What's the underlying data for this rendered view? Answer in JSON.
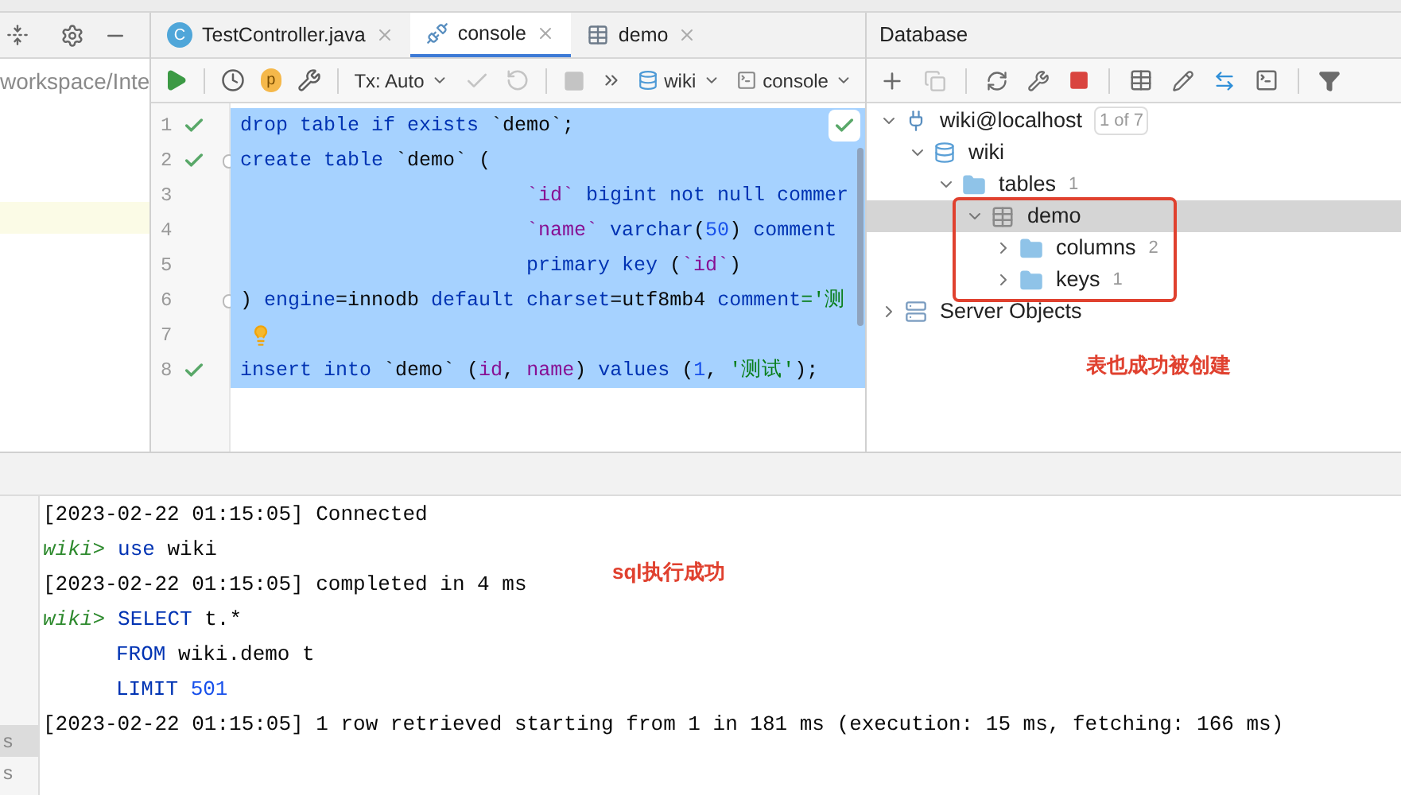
{
  "left_panel": {
    "path": "workspace/Inte",
    "bottom_items": [
      "s",
      "s"
    ]
  },
  "editor": {
    "tabs": [
      {
        "label": "TestController.java",
        "kind": "class",
        "icon_letter": "C",
        "selected": false
      },
      {
        "label": "console",
        "kind": "console",
        "selected": true
      },
      {
        "label": "demo",
        "kind": "table",
        "selected": false
      }
    ],
    "toolbar": [
      {
        "kind": "run",
        "disabled": false
      },
      {
        "kind": "sep"
      },
      {
        "kind": "history",
        "disabled": false
      },
      {
        "kind": "letter",
        "text": "p",
        "disabled": false
      },
      {
        "kind": "settings",
        "disabled": false
      },
      {
        "kind": "sep"
      },
      {
        "kind": "dropdown",
        "text": "Tx: Auto",
        "disabled": false
      },
      {
        "kind": "commit",
        "disabled": true
      },
      {
        "kind": "rollback",
        "disabled": true
      },
      {
        "kind": "sep"
      },
      {
        "kind": "stop",
        "disabled": true
      },
      {
        "kind": "more",
        "disabled": false
      },
      {
        "kind": "schema",
        "text": "wiki",
        "disabled": false
      },
      {
        "kind": "session",
        "text": "console",
        "disabled": false
      }
    ],
    "lines": [
      {
        "number": "1",
        "checked": true,
        "fold": false,
        "indented": false,
        "bulb": false,
        "tokens": [
          {
            "t": "drop table if exists",
            "kind": "kw"
          },
          {
            "t": " `demo`;",
            "kind": "plain"
          }
        ]
      },
      {
        "number": "2",
        "checked": true,
        "fold": true,
        "indented": false,
        "bulb": false,
        "tokens": [
          {
            "t": "create table",
            "kind": "kw"
          },
          {
            "t": " `demo` (",
            "kind": "plain"
          }
        ]
      },
      {
        "number": "3",
        "checked": false,
        "fold": false,
        "indented": true,
        "bulb": false,
        "tokens": [
          {
            "t": "`id`",
            "kind": "id"
          },
          {
            "t": " bigint not null commer",
            "kind": "kw"
          }
        ]
      },
      {
        "number": "4",
        "checked": false,
        "fold": false,
        "indented": true,
        "bulb": false,
        "tokens": [
          {
            "t": "`name`",
            "kind": "id"
          },
          {
            "t": " varchar",
            "kind": "kw"
          },
          {
            "t": "(",
            "kind": "plain"
          },
          {
            "t": "50",
            "kind": "num"
          },
          {
            "t": ")",
            "kind": "plain"
          },
          {
            "t": " comment",
            "kind": "kw"
          }
        ]
      },
      {
        "number": "5",
        "checked": false,
        "fold": false,
        "indented": true,
        "bulb": false,
        "tokens": [
          {
            "t": "primary key",
            "kind": "kw"
          },
          {
            "t": " (",
            "kind": "plain"
          },
          {
            "t": "`id`",
            "kind": "id"
          },
          {
            "t": ")",
            "kind": "plain"
          }
        ]
      },
      {
        "number": "6",
        "checked": false,
        "fold": true,
        "indented": false,
        "bulb": false,
        "tokens": [
          {
            "t": ") ",
            "kind": "plain"
          },
          {
            "t": "engine",
            "kind": "kw"
          },
          {
            "t": "=innodb ",
            "kind": "plain"
          },
          {
            "t": "default charset",
            "kind": "kw"
          },
          {
            "t": "=utf8mb4 ",
            "kind": "plain"
          },
          {
            "t": "comment",
            "kind": "kw"
          },
          {
            "t": "='测",
            "kind": "str"
          }
        ]
      },
      {
        "number": "7",
        "checked": false,
        "fold": false,
        "indented": false,
        "bulb": true
      },
      {
        "number": "8",
        "checked": true,
        "fold": false,
        "indented": false,
        "bulb": false,
        "tokens": [
          {
            "t": "insert into",
            "kind": "kw"
          },
          {
            "t": " `demo` (",
            "kind": "plain"
          },
          {
            "t": "id",
            "kind": "id"
          },
          {
            "t": ", ",
            "kind": "plain"
          },
          {
            "t": "name",
            "kind": "id"
          },
          {
            "t": ") ",
            "kind": "plain"
          },
          {
            "t": "values",
            "kind": "kw"
          },
          {
            "t": " (",
            "kind": "plain"
          },
          {
            "t": "1",
            "kind": "num"
          },
          {
            "t": ", ",
            "kind": "plain"
          },
          {
            "t": "'测试'",
            "kind": "str"
          },
          {
            "t": ");",
            "kind": "plain"
          }
        ]
      }
    ]
  },
  "database": {
    "title": "Database",
    "toolbar": [
      {
        "kind": "add"
      },
      {
        "kind": "copy"
      },
      {
        "kind": "sep"
      },
      {
        "kind": "refresh"
      },
      {
        "kind": "edit-schema"
      },
      {
        "kind": "stop"
      },
      {
        "kind": "sep"
      },
      {
        "kind": "table"
      },
      {
        "kind": "edit"
      },
      {
        "kind": "jump"
      },
      {
        "kind": "console"
      },
      {
        "kind": "sep"
      },
      {
        "kind": "filter"
      }
    ],
    "tree": [
      {
        "label": "wiki@localhost",
        "badge": "1 of 7",
        "kind": "connection",
        "expanded": true,
        "selected": false,
        "annotated": false,
        "children": [
          {
            "label": "wiki",
            "kind": "schema",
            "expanded": true,
            "selected": false,
            "annotated": false,
            "children": [
              {
                "label": "tables",
                "count": "1",
                "kind": "folder",
                "expanded": true,
                "selected": false,
                "annotated": false,
                "children": [
                  {
                    "label": "demo",
                    "kind": "table",
                    "expanded": true,
                    "selected": true,
                    "annotated": true,
                    "children": [
                      {
                        "label": "columns",
                        "count": "2",
                        "kind": "folder",
                        "expanded": false,
                        "selected": false,
                        "annotated": false
                      },
                      {
                        "label": "keys",
                        "count": "1",
                        "kind": "folder",
                        "expanded": false,
                        "selected": false,
                        "annotated": false
                      }
                    ]
                  }
                ]
              }
            ]
          }
        ]
      },
      {
        "label": "Server Objects",
        "kind": "server",
        "expanded": false,
        "selected": false,
        "annotated": false
      }
    ],
    "note": "表也成功被创建"
  },
  "console": {
    "note": "sql执行成功",
    "lines": [
      {
        "kind": "log",
        "tokens": [
          {
            "t": "[2023-02-22 01:15:05] Connected",
            "kind": "plain"
          }
        ]
      },
      {
        "kind": "prompt",
        "prompt": "wiki>",
        "tokens": [
          {
            "t": "use",
            "kind": "kw"
          },
          {
            "t": " wiki",
            "kind": "plain"
          }
        ]
      },
      {
        "kind": "log",
        "tokens": [
          {
            "t": "[2023-02-22 01:15:05] completed in 4 ms",
            "kind": "plain"
          }
        ]
      },
      {
        "kind": "prompt",
        "prompt": "wiki>",
        "tokens": [
          {
            "t": "SELECT",
            "kind": "kw"
          },
          {
            "t": " t.*",
            "kind": "plain"
          }
        ]
      },
      {
        "kind": "cont",
        "tokens": [
          {
            "t": "FROM",
            "kind": "kw"
          },
          {
            "t": " wiki.demo t",
            "kind": "plain"
          }
        ]
      },
      {
        "kind": "cont",
        "tokens": [
          {
            "t": "LIMIT",
            "kind": "kw"
          },
          {
            "t": " 501",
            "kind": "num"
          }
        ]
      },
      {
        "kind": "log",
        "tokens": [
          {
            "t": "[2023-02-22 01:15:05] 1 row retrieved starting from 1 in 181 ms (execution: 15 ms, fetching: 166 ms)",
            "kind": "plain"
          }
        ]
      }
    ]
  }
}
